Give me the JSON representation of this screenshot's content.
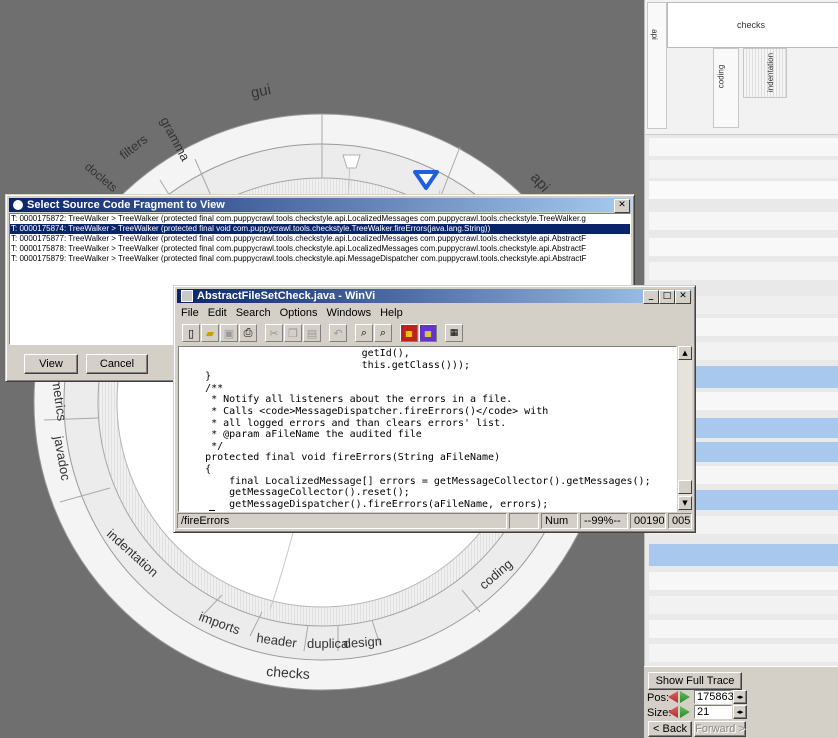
{
  "radial": {
    "outer_labels": [
      "checks"
    ],
    "ring_labels": [
      "gui",
      "grammar",
      "filters",
      "doclets",
      "api",
      "metrics",
      "javadoc",
      "indentation",
      "imports",
      "header",
      "duplicates",
      "design",
      "coding"
    ],
    "ring_labels_display": [
      "gui",
      "gramma",
      "filters",
      "doclets",
      "api",
      "metrics",
      "javadoc",
      "indentation",
      "imports",
      "header",
      "duplica",
      "design",
      "coding"
    ]
  },
  "rightpanel": {
    "top_labels": {
      "api": "api",
      "checks": "checks",
      "coding": "coding",
      "indentation": "indentation"
    },
    "show_full_trace": "Show Full Trace",
    "pos_label": "Pos:",
    "pos_value": "175863",
    "size_label": "Size:",
    "size_value": "21",
    "back": "< Back",
    "forward": "Forward >",
    "highlight_color": "#a9c8ee"
  },
  "select_dialog": {
    "title": "Select Source Code Fragment to View",
    "close": "✕",
    "rows": [
      "T: 0000175872: TreeWalker > TreeWalker (protected final com.puppycrawl.tools.checkstyle.api.LocalizedMessages com.puppycrawl.tools.checkstyle.TreeWalker.g",
      "T: 0000175874: TreeWalker > TreeWalker (protected final void com.puppycrawl.tools.checkstyle.TreeWalker.fireErrors(java.lang.String))",
      "T: 0000175877: TreeWalker > TreeWalker (protected final com.puppycrawl.tools.checkstyle.api.LocalizedMessages com.puppycrawl.tools.checkstyle.api.AbstractF",
      "T: 0000175878: TreeWalker > TreeWalker (protected final com.puppycrawl.tools.checkstyle.api.LocalizedMessages com.puppycrawl.tools.checkstyle.api.AbstractF",
      "T: 0000175879: TreeWalker > TreeWalker (protected final com.puppycrawl.tools.checkstyle.api.MessageDispatcher com.puppycrawl.tools.checkstyle.api.AbstractF"
    ],
    "selected_index": 1,
    "view": "View",
    "cancel": "Cancel"
  },
  "editor_window": {
    "title": "AbstractFileSetCheck.java - WinVi",
    "title_buttons": [
      "_",
      "□",
      "✕"
    ],
    "menu": [
      "File",
      "Edit",
      "Search",
      "Options",
      "Windows",
      "Help"
    ],
    "code": [
      "                              getId(),",
      "                              this.getClass()));",
      "    }",
      "",
      "    /**",
      "     * Notify all listeners about the errors in a file.",
      "     * Calls <code>MessageDispatcher.fireErrors()</code> with",
      "     * all logged errors and than clears errors' list.",
      "     * @param aFileName the audited file",
      "     */",
      "    protected final void fireErrors(String aFileName)",
      "    {",
      "        final LocalizedMessage[] errors = getMessageCollector().getMessages();",
      "        getMessageCollector().reset();",
      "        getMessageDispatcher().fireErrors(aFileName, errors);",
      "    }",
      "}"
    ],
    "status": {
      "search": "/fireErrors",
      "num": "Num",
      "percent": "--99%--",
      "line": "00190",
      "col": "005"
    }
  }
}
